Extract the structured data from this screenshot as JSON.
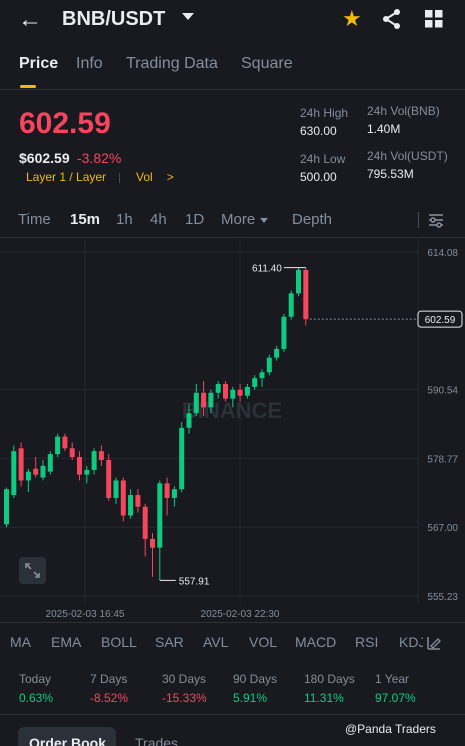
{
  "header": {
    "back_icon": "back-arrow-icon",
    "pair": "BNB/USDT",
    "icons": [
      "chevron-down-icon",
      "star-icon",
      "share-icon",
      "grid-icon"
    ]
  },
  "tabs": [
    {
      "label": "Price",
      "active": true
    },
    {
      "label": "Info"
    },
    {
      "label": "Trading Data"
    },
    {
      "label": "Square"
    }
  ],
  "ticker": {
    "last_price": "602.59",
    "usd_price": "$602.59",
    "change": "-3.82%",
    "tag_category": "Layer 1 / Layer",
    "tag_vol": "Vol",
    "tag_vol_arrow": ">",
    "stats": {
      "high_label": "24h High",
      "high_value": "630.00",
      "low_label": "24h Low",
      "low_value": "500.00",
      "vol_bnb_label": "24h Vol(BNB)",
      "vol_bnb_value": "1.40M",
      "vol_usdt_label": "24h Vol(USDT)",
      "vol_usdt_value": "795.53M"
    }
  },
  "timeframes": [
    {
      "label": "Time"
    },
    {
      "label": "15m",
      "active": true
    },
    {
      "label": "1h"
    },
    {
      "label": "4h"
    },
    {
      "label": "1D"
    },
    {
      "label": "More"
    },
    {
      "label": "Depth"
    }
  ],
  "chart_data": {
    "type": "candlestick",
    "y_ticks": [
      "614.08",
      "602.59",
      "590.54",
      "578.77",
      "567.00",
      "555.23"
    ],
    "ylim": [
      555.23,
      614.08
    ],
    "x_labels": [
      "2025-02-03 16:45",
      "2025-02-03 22:30"
    ],
    "last_price_label": "602.59",
    "high_marker": "611.40",
    "low_marker": "557.91",
    "watermark": "BINANCE",
    "colors": {
      "up": "#0ecb81",
      "down": "#f6465d"
    },
    "candles": [
      {
        "o": 567.5,
        "h": 573.8,
        "l": 567.0,
        "c": 573.5
      },
      {
        "o": 572.5,
        "h": 581.0,
        "l": 572.0,
        "c": 580.0
      },
      {
        "o": 580.5,
        "h": 581.5,
        "l": 574.0,
        "c": 575.0
      },
      {
        "o": 575.0,
        "h": 577.0,
        "l": 573.0,
        "c": 576.5
      },
      {
        "o": 577.0,
        "h": 579.0,
        "l": 575.5,
        "c": 576.0
      },
      {
        "o": 575.5,
        "h": 578.5,
        "l": 575.0,
        "c": 577.5
      },
      {
        "o": 576.5,
        "h": 580.0,
        "l": 576.0,
        "c": 579.5
      },
      {
        "o": 579.5,
        "h": 583.0,
        "l": 579.0,
        "c": 582.5
      },
      {
        "o": 582.5,
        "h": 583.0,
        "l": 580.0,
        "c": 580.5
      },
      {
        "o": 580.5,
        "h": 581.5,
        "l": 578.5,
        "c": 579.0
      },
      {
        "o": 579.0,
        "h": 580.0,
        "l": 575.0,
        "c": 576.0
      },
      {
        "o": 576.0,
        "h": 577.5,
        "l": 574.5,
        "c": 576.8
      },
      {
        "o": 576.8,
        "h": 580.5,
        "l": 576.0,
        "c": 580.0
      },
      {
        "o": 580.0,
        "h": 581.0,
        "l": 577.5,
        "c": 578.5
      },
      {
        "o": 578.5,
        "h": 579.5,
        "l": 571.5,
        "c": 572.0
      },
      {
        "o": 572.0,
        "h": 575.5,
        "l": 571.0,
        "c": 575.0
      },
      {
        "o": 575.0,
        "h": 575.5,
        "l": 568.0,
        "c": 569.0
      },
      {
        "o": 569.0,
        "h": 573.5,
        "l": 568.5,
        "c": 572.5
      },
      {
        "o": 572.5,
        "h": 573.5,
        "l": 569.5,
        "c": 570.5
      },
      {
        "o": 570.5,
        "h": 571.0,
        "l": 562.0,
        "c": 565.0
      },
      {
        "o": 565.0,
        "h": 566.0,
        "l": 558.5,
        "c": 563.5
      },
      {
        "o": 563.5,
        "h": 575.0,
        "l": 557.91,
        "c": 574.5
      },
      {
        "o": 574.5,
        "h": 575.5,
        "l": 569.0,
        "c": 572.0
      },
      {
        "o": 572.0,
        "h": 574.0,
        "l": 570.5,
        "c": 573.5
      },
      {
        "o": 573.5,
        "h": 585.0,
        "l": 573.0,
        "c": 584.0
      },
      {
        "o": 584.0,
        "h": 588.0,
        "l": 583.0,
        "c": 586.5
      },
      {
        "o": 586.5,
        "h": 591.5,
        "l": 586.0,
        "c": 590.0
      },
      {
        "o": 590.0,
        "h": 592.0,
        "l": 586.0,
        "c": 587.5
      },
      {
        "o": 587.5,
        "h": 590.5,
        "l": 586.5,
        "c": 590.0
      },
      {
        "o": 590.0,
        "h": 592.0,
        "l": 589.0,
        "c": 591.5
      },
      {
        "o": 591.5,
        "h": 592.0,
        "l": 588.5,
        "c": 589.0
      },
      {
        "o": 589.0,
        "h": 591.0,
        "l": 587.5,
        "c": 590.5
      },
      {
        "o": 590.5,
        "h": 591.5,
        "l": 588.5,
        "c": 589.5
      },
      {
        "o": 589.5,
        "h": 591.5,
        "l": 589.0,
        "c": 591.0
      },
      {
        "o": 591.0,
        "h": 593.0,
        "l": 590.5,
        "c": 592.5
      },
      {
        "o": 592.5,
        "h": 594.0,
        "l": 591.0,
        "c": 593.5
      },
      {
        "o": 593.5,
        "h": 596.5,
        "l": 593.0,
        "c": 596.0
      },
      {
        "o": 596.0,
        "h": 598.0,
        "l": 595.5,
        "c": 597.5
      },
      {
        "o": 597.5,
        "h": 603.5,
        "l": 597.0,
        "c": 603.0
      },
      {
        "o": 603.0,
        "h": 607.5,
        "l": 602.5,
        "c": 607.0
      },
      {
        "o": 607.0,
        "h": 611.4,
        "l": 606.5,
        "c": 611.0
      },
      {
        "o": 611.0,
        "h": 611.4,
        "l": 601.5,
        "c": 602.59
      }
    ]
  },
  "indicators": [
    "MA",
    "EMA",
    "BOLL",
    "SAR",
    "AVL",
    "VOL",
    "MACD",
    "RSI",
    "KDJ"
  ],
  "performance": [
    {
      "label": "Today",
      "value": "0.63%",
      "dir": "up"
    },
    {
      "label": "7 Days",
      "value": "-8.52%",
      "dir": "down"
    },
    {
      "label": "30 Days",
      "value": "-15.33%",
      "dir": "down"
    },
    {
      "label": "90 Days",
      "value": "5.91%",
      "dir": "up"
    },
    {
      "label": "180 Days",
      "value": "11.31%",
      "dir": "up"
    },
    {
      "label": "1 Year",
      "value": "97.07%",
      "dir": "up"
    }
  ],
  "bottom_tabs": [
    {
      "label": "Order Book",
      "active": true
    },
    {
      "label": "Trades"
    }
  ],
  "watermark_credit": "@Panda Traders"
}
